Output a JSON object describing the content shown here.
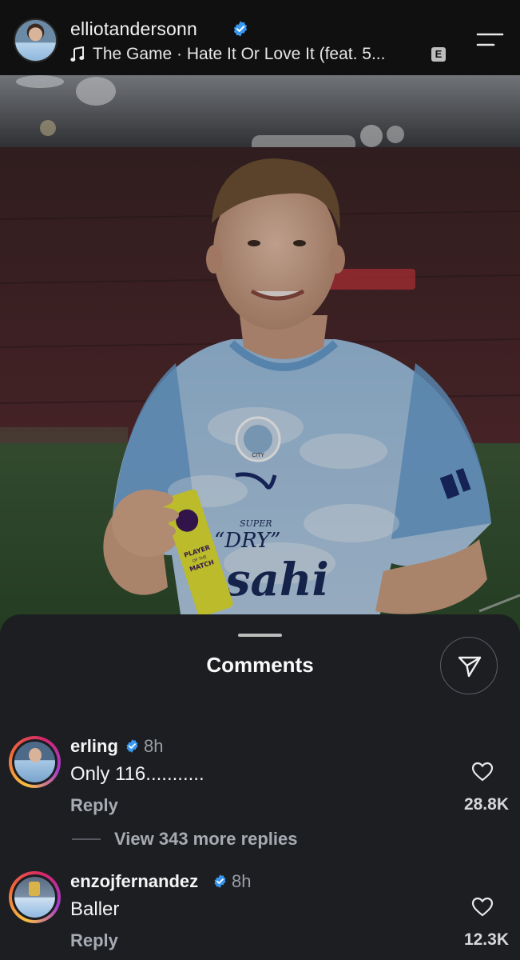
{
  "header": {
    "username": "elliotandersonn",
    "music": "The Game · Hate It Or Love It (feat. 5...",
    "explicit_badge": "E",
    "avatar_icon": "profile-avatar",
    "menu_icon": "menu-icon"
  },
  "photo": {
    "jersey_text_super": "SUPER",
    "jersey_text_dry": "“DRY”",
    "jersey_text_sponsor": "sahi",
    "armband_line1": "PLAYER",
    "armband_line2": "OF THE",
    "armband_line3": "MATCH",
    "badge_text": "CITY"
  },
  "sheet": {
    "title": "Comments",
    "share_icon": "send-icon"
  },
  "comments": [
    {
      "username": "erling",
      "verified": true,
      "time": "8h",
      "text": "Only 116...........",
      "reply_label": "Reply",
      "likes": "28.8K",
      "view_replies": "View 343 more replies"
    },
    {
      "username": "enzojfernandez",
      "verified": true,
      "time": "8h",
      "text": "Baller",
      "reply_label": "Reply",
      "likes": "12.3K"
    }
  ],
  "colors": {
    "verified": "#3897f0",
    "sheet_bg": "#1c1e22",
    "header_bg": "#101010"
  }
}
